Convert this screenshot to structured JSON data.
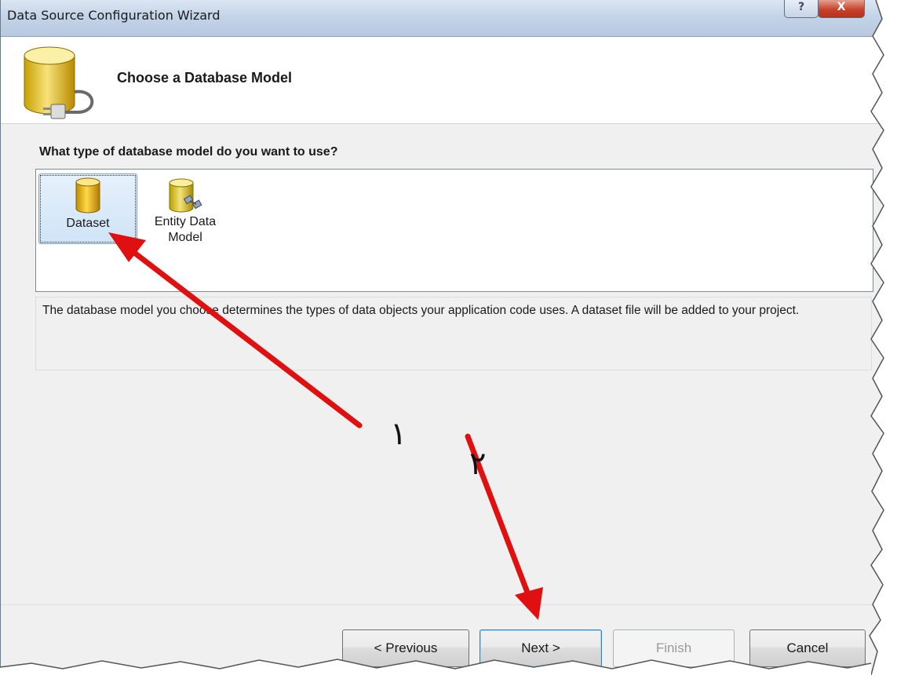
{
  "window": {
    "title": "Data Source Configuration Wizard",
    "help_label": "?",
    "close_label": "X"
  },
  "header": {
    "title": "Choose a Database Model",
    "icon": "database-plug-icon"
  },
  "question": "What type of database model do you want to use?",
  "models": [
    {
      "label": "Dataset",
      "icon": "dataset-cylinder-icon",
      "selected": true
    },
    {
      "label_line1": "Entity Data",
      "label_line2": "Model",
      "icon": "entity-data-model-icon",
      "selected": false
    }
  ],
  "description": "The database model you choose determines the types of data objects your application code uses. A dataset file will be added to your project.",
  "buttons": {
    "previous": "< Previous",
    "next": "Next >",
    "finish": "Finish",
    "cancel": "Cancel"
  },
  "annotations": {
    "step1": "١",
    "step2": "٢",
    "arrow_color": "#e01010"
  },
  "colors": {
    "selected_bg": "#cfe4f7",
    "title_bar": "#c4d4e8",
    "close_button": "#c7432a"
  }
}
